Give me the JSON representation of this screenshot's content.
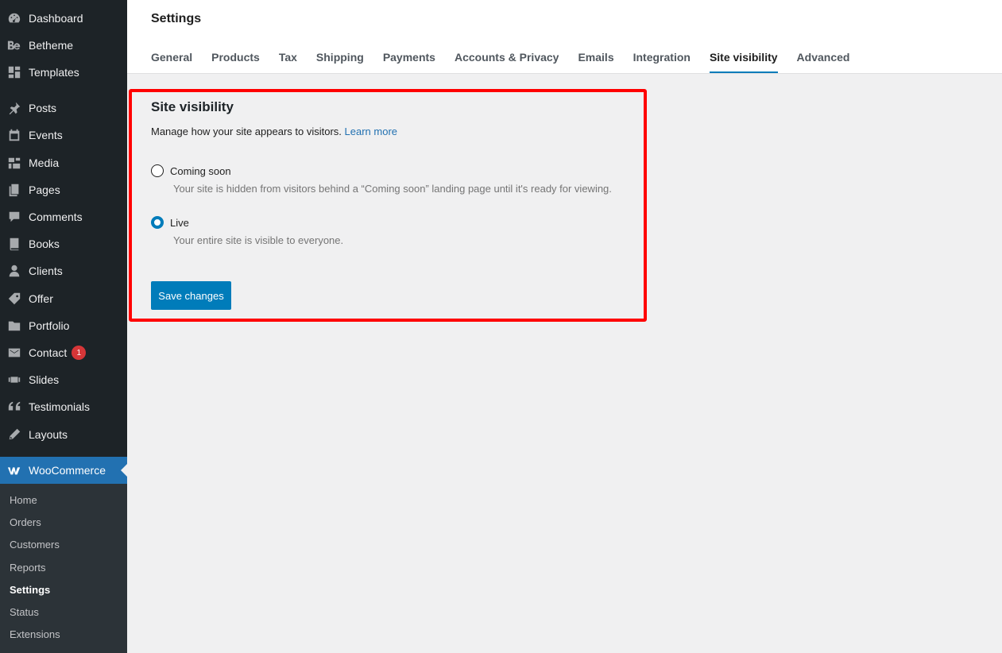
{
  "sidebar": {
    "items": [
      {
        "label": "Dashboard",
        "icon": "dashboard-icon"
      },
      {
        "label": "Betheme",
        "icon": "betheme-icon"
      },
      {
        "label": "Templates",
        "icon": "templates-icon"
      },
      {
        "label": "Posts",
        "icon": "pin-icon"
      },
      {
        "label": "Events",
        "icon": "calendar-icon"
      },
      {
        "label": "Media",
        "icon": "media-icon"
      },
      {
        "label": "Pages",
        "icon": "pages-icon"
      },
      {
        "label": "Comments",
        "icon": "comment-icon"
      },
      {
        "label": "Books",
        "icon": "book-icon"
      },
      {
        "label": "Clients",
        "icon": "user-icon"
      },
      {
        "label": "Offer",
        "icon": "tag-icon"
      },
      {
        "label": "Portfolio",
        "icon": "folder-icon"
      },
      {
        "label": "Contact",
        "icon": "envelope-icon",
        "badge": "1"
      },
      {
        "label": "Slides",
        "icon": "slides-icon"
      },
      {
        "label": "Testimonials",
        "icon": "quote-icon"
      },
      {
        "label": "Layouts",
        "icon": "pencil-icon"
      },
      {
        "label": "WooCommerce",
        "icon": "woocommerce-icon"
      }
    ],
    "submenu": [
      "Home",
      "Orders",
      "Customers",
      "Reports",
      "Settings",
      "Status",
      "Extensions"
    ]
  },
  "header": {
    "title": "Settings",
    "tabs": [
      "General",
      "Products",
      "Tax",
      "Shipping",
      "Payments",
      "Accounts & Privacy",
      "Emails",
      "Integration",
      "Site visibility",
      "Advanced"
    ]
  },
  "section": {
    "title": "Site visibility",
    "description": "Manage how your site appears to visitors.",
    "learn_more": "Learn more",
    "options": [
      {
        "label": "Coming soon",
        "help": "Your site is hidden from visitors behind a “Coming soon” landing page until it's ready for viewing.",
        "checked": false
      },
      {
        "label": "Live",
        "help": "Your entire site is visible to everyone.",
        "checked": true
      }
    ],
    "save_label": "Save changes"
  },
  "colors": {
    "sidebar_bg": "#1d2327",
    "accent": "#007cba",
    "highlight_border": "#ff0000",
    "badge": "#d63638"
  }
}
